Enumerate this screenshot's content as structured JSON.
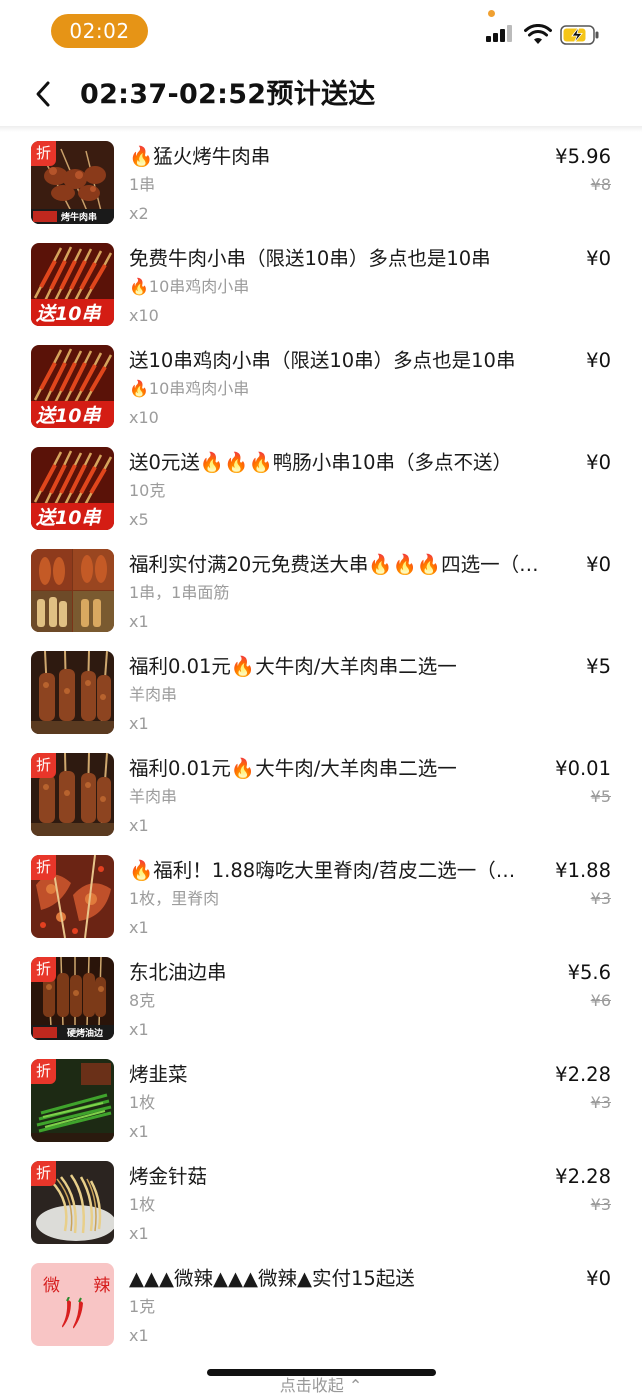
{
  "status": {
    "time": "02:02"
  },
  "header": {
    "title": "02:37-02:52预计送达"
  },
  "colors": {
    "accent": "#e69416",
    "badge": "#e8362a",
    "muted": "#9c9c9c"
  },
  "items": [
    {
      "name": "🔥猛火烤牛肉串",
      "spec": "1串",
      "qty": "x2",
      "price": "¥5.96",
      "original_price": "¥8",
      "badge": "折",
      "image": "beef-skewers",
      "image_caption": "烤牛肉串"
    },
    {
      "name": "免费牛肉小串（限送10串）多点也是10串",
      "spec": "🔥10串鸡肉小串",
      "qty": "x10",
      "price": "¥0",
      "original_price": "",
      "badge": "",
      "image": "free-10-skewers",
      "image_caption": "送10串"
    },
    {
      "name": "送10串鸡肉小串（限送10串）多点也是10串",
      "spec": "🔥10串鸡肉小串",
      "qty": "x10",
      "price": "¥0",
      "original_price": "",
      "badge": "",
      "image": "free-10-skewers",
      "image_caption": "送10串"
    },
    {
      "name": "送0元送🔥🔥🔥鸭肠小串10串（多点不送）",
      "spec": "10克",
      "qty": "x5",
      "price": "¥0",
      "original_price": "",
      "badge": "",
      "image": "free-10-skewers",
      "image_caption": "送10串"
    },
    {
      "name": "福利实付满20元免费送大串🔥🔥🔥四选一（…",
      "spec": "1串，1串面筋",
      "qty": "x1",
      "price": "¥0",
      "original_price": "",
      "badge": "",
      "image": "four-choice-skewers",
      "image_caption": ""
    },
    {
      "name": "福利0.01元🔥大牛肉/大羊肉串二选一",
      "spec": "羊肉串",
      "qty": "x1",
      "price": "¥5",
      "original_price": "",
      "badge": "",
      "image": "big-meat-skewers",
      "image_caption": ""
    },
    {
      "name": "福利0.01元🔥大牛肉/大羊肉串二选一",
      "spec": "羊肉串",
      "qty": "x1",
      "price": "¥0.01",
      "original_price": "¥5",
      "badge": "折",
      "image": "big-meat-skewers",
      "image_caption": ""
    },
    {
      "name": "🔥福利！1.88嗨吃大里脊肉/苕皮二选一（…",
      "spec": "1枚，里脊肉",
      "qty": "x1",
      "price": "¥1.88",
      "original_price": "¥3",
      "badge": "折",
      "image": "tenderloin",
      "image_caption": ""
    },
    {
      "name": "东北油边串",
      "spec": "8克",
      "qty": "x1",
      "price": "¥5.6",
      "original_price": "¥6",
      "badge": "折",
      "image": "fat-edge-skewers",
      "image_caption": "硬烤油边"
    },
    {
      "name": "烤韭菜",
      "spec": "1枚",
      "qty": "x1",
      "price": "¥2.28",
      "original_price": "¥3",
      "badge": "折",
      "image": "chives",
      "image_caption": ""
    },
    {
      "name": "烤金针菇",
      "spec": "1枚",
      "qty": "x1",
      "price": "¥2.28",
      "original_price": "¥3",
      "badge": "折",
      "image": "enoki",
      "image_caption": ""
    },
    {
      "name": "▲▲▲微辣▲▲▲微辣▲实付15起送",
      "spec": "1克",
      "qty": "x1",
      "price": "¥0",
      "original_price": "",
      "badge": "",
      "image": "mild-spicy",
      "image_caption": "微 辣"
    }
  ],
  "footer": {
    "collapse_label": "点击收起 ⌃"
  }
}
